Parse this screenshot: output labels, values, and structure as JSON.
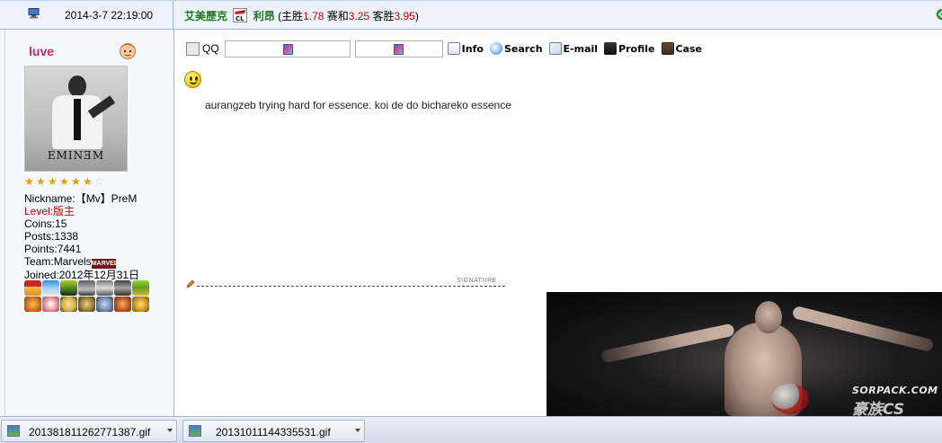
{
  "header": {
    "post_date": "2014-3-7 22:19:00",
    "match": {
      "home_team": "艾美歷克",
      "away_team": "利昂",
      "home_win_label": "(主胜",
      "home_win_odds": "1.78",
      "draw_label": "赛和",
      "draw_odds": "3.25",
      "away_win_label": "客胜",
      "away_win_odds": "3.95",
      "close_paren": ")"
    },
    "competition_logo_text": "CL"
  },
  "user": {
    "username": "luve",
    "avatar_caption": "EMINƎM",
    "stars_filled": 6,
    "stars_total": 7,
    "nickname_label": "Nickname:",
    "nickname_value": "【Mv】PreM",
    "level_label": "Level:",
    "level_value": "版主",
    "coins_label": "Coins:",
    "coins_value": "15",
    "posts_label": "Posts:",
    "posts_value": "1338",
    "points_label": "Points:",
    "points_value": "7441",
    "team_label": "Team:",
    "team_value": "Marvels",
    "team_badge_text": "MARVEL",
    "joined_label": "Joined:",
    "joined_value": "2012年12月31日"
  },
  "toolbar": {
    "qq_label": "QQ",
    "info_label": "Info",
    "search_label": "Search",
    "email_label": "E-mail",
    "profile_label": "Profile",
    "case_label": "Case"
  },
  "post": {
    "message": "aurangzeb trying hard for essence. koi de do bichareko essence",
    "signature_label": "SIGNATURE"
  },
  "signature_image": {
    "watermark_top": "SORPACK.COM",
    "watermark_bottom": "豪族CS"
  },
  "downloads": [
    {
      "filename": "201381811262771387.gif"
    },
    {
      "filename": "20131011144335531.gif"
    }
  ],
  "colors": {
    "header_bg": "#eef2fb",
    "border": "#9fb4d9",
    "team_name": "#1b7a1b",
    "odds": "#d40000",
    "username": "#c0286a",
    "level": "#cc0000"
  }
}
